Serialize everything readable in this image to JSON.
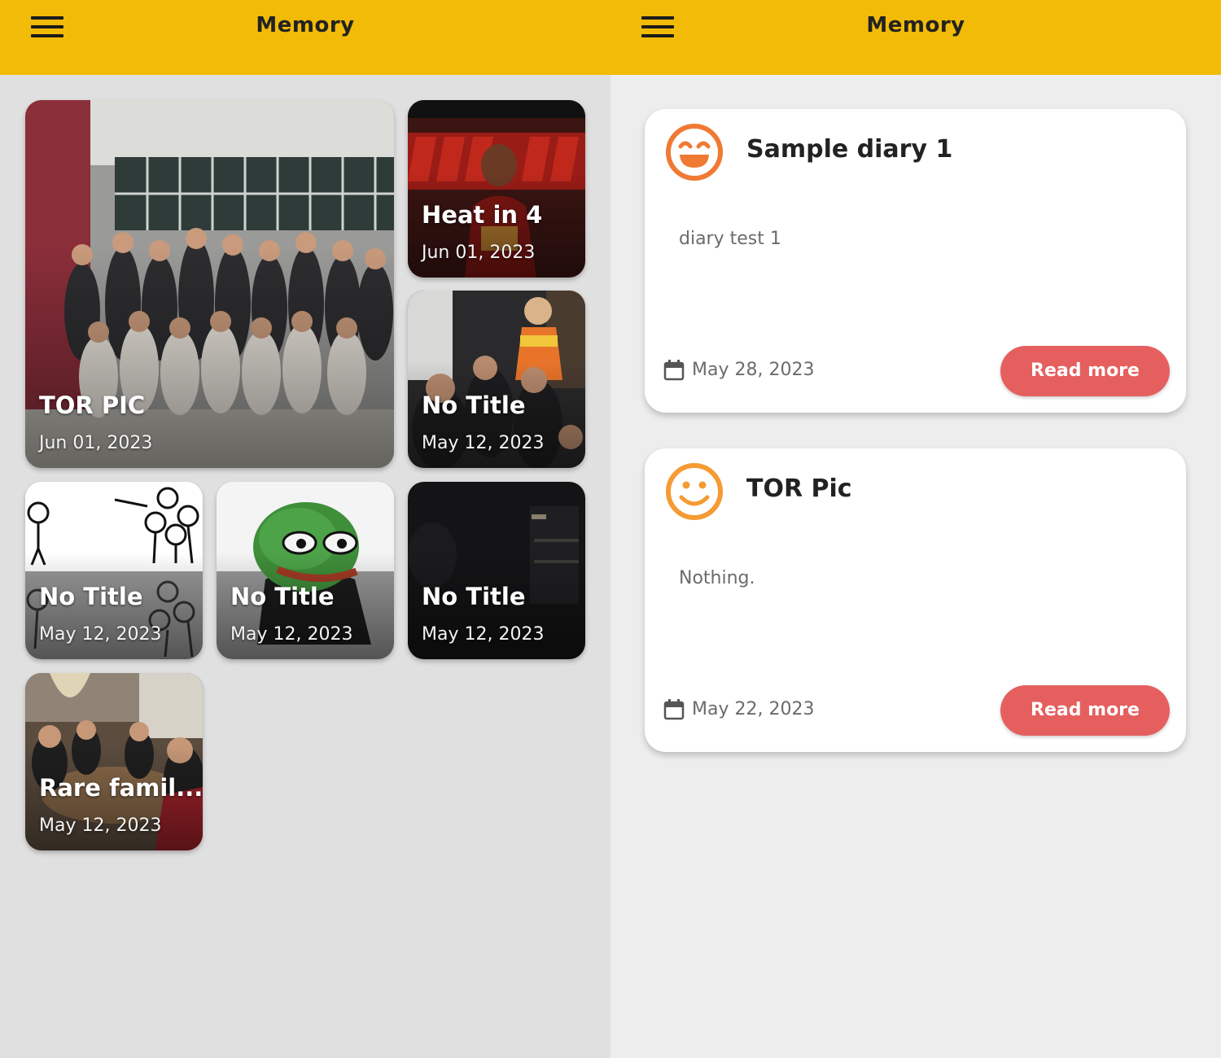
{
  "colors": {
    "accent": "#f2bb08",
    "button": "#e65f5f",
    "mood_happy": "#f07a34",
    "mood_smile": "#f59b33"
  },
  "left_screen": {
    "header": {
      "title": "Memory",
      "menu_icon": "hamburger-menu-icon"
    },
    "memories": [
      {
        "title": "TOR PIC",
        "date": "Jun 01, 2023"
      },
      {
        "title": "Heat in 4",
        "date": "Jun 01, 2023"
      },
      {
        "title": "No Title",
        "date": "May 12, 2023"
      },
      {
        "title": "No Title",
        "date": "May 12, 2023"
      },
      {
        "title": "No Title",
        "date": "May 12, 2023"
      },
      {
        "title": "No Title",
        "date": "May 12, 2023"
      },
      {
        "title": "Rare famil...",
        "date": "May 12, 2023"
      }
    ]
  },
  "right_screen": {
    "header": {
      "title": "Memory",
      "menu_icon": "hamburger-menu-icon"
    },
    "diaries": [
      {
        "title": "Sample diary 1",
        "body": "diary test 1",
        "date": "May 28, 2023",
        "mood_icon": "laughing-face-icon",
        "button": "Read more"
      },
      {
        "title": "TOR Pic",
        "body": "Nothing.",
        "date": "May 22, 2023",
        "mood_icon": "smiling-face-icon",
        "button": "Read more"
      }
    ]
  }
}
